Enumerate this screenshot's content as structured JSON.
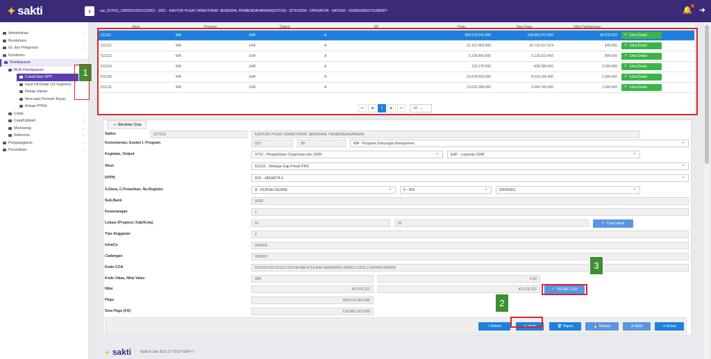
{
  "app": {
    "logo": "sakti",
    "header_info": "opr_527010_199503152016122001 - 2021 - KANTOR PUSAT DIREKTORAT JENDERAL PERBENDAHARAAN(527010) - 527010009 - OPERATOR - SATKER - 0150601995270100000?",
    "bell_icon": "bell-icon",
    "logout_icon": "logout-icon",
    "accent": "#3a2a78"
  },
  "sidebar": {
    "items": [
      {
        "label": "Administrasi",
        "level": 1,
        "dropdown": true
      },
      {
        "label": "Bendahara",
        "level": 1,
        "dropdown": true
      },
      {
        "label": "GL dan Pelaporan",
        "level": 1,
        "dropdown": true
      },
      {
        "label": "Komitmen",
        "level": 1,
        "dropdown": false
      },
      {
        "label": "Pembayaran",
        "level": 1,
        "dropdown": false
      },
      {
        "label": "RUH Pembayaran",
        "level": 2,
        "dropdown": false
      },
      {
        "label": "Catat/Ubah SPP",
        "level": 3,
        "dropdown": false
      },
      {
        "label": "Input FA Detail (16 Segmen)",
        "level": 3,
        "dropdown": false
      },
      {
        "label": "Rekap Harian",
        "level": 3,
        "dropdown": false
      },
      {
        "label": "Mencatat Perintah Bayar",
        "level": 3,
        "dropdown": false
      },
      {
        "label": "Rekap PPDH",
        "level": 3,
        "dropdown": false
      },
      {
        "label": "Cetak",
        "level": 2,
        "dropdown": true
      },
      {
        "label": "Catat/Upload",
        "level": 2,
        "dropdown": true
      },
      {
        "label": "Monitoring",
        "level": 2,
        "dropdown": true
      },
      {
        "label": "Referensi",
        "level": 2,
        "dropdown": true
      },
      {
        "label": "Penganggaran",
        "level": 1,
        "dropdown": true
      },
      {
        "label": "Persediaan",
        "level": 1,
        "dropdown": true
      }
    ]
  },
  "grid": {
    "headers": [
      "Akun",
      "Program",
      "Output",
      "SD",
      "Pagu",
      "Sisa Pagu",
      "Nilai Pembayaran",
      ""
    ],
    "rows": [
      {
        "akun": "511111",
        "program": "WA",
        "output": "EAF",
        "sd": "A",
        "pagu": "309.573.242.000",
        "sisa": "139.962.972.050",
        "nilai": "42.578.222",
        "action": "Lihat Detail"
      },
      {
        "akun": "511121",
        "program": "WA",
        "output": "EAF",
        "sd": "A",
        "pagu": "22.167.969.000",
        "sisa": "20.710.017.014",
        "nilai": "400.000",
        "action": "Lihat Detail"
      },
      {
        "akun": "511122",
        "program": "WA",
        "output": "EAF",
        "sd": "A",
        "pagu": "6.190.443.000",
        "sisa": "5.126.013.443",
        "nilai": "804.000",
        "action": "Lihat Detail"
      },
      {
        "akun": "511124",
        "program": "WA",
        "output": "EAF",
        "sd": "A",
        "pagu": "310.375.000",
        "sisa": "-428.390.000",
        "nilai": "3.000.000",
        "action": "Lihat Detail"
      },
      {
        "akun": "511126",
        "program": "WA",
        "output": "EAF",
        "sd": "A",
        "pagu": "16.978.929.000",
        "sisa": "8.019.146.400",
        "nilai": "2.000.000",
        "action": "Lihat Detail"
      },
      {
        "akun": "511131",
        "program": "WA",
        "output": "EAF",
        "sd": "A",
        "pagu": "13.032.289.000",
        "sisa": "6.944.745.000",
        "nilai": "1.000.000",
        "action": "Lihat Detail"
      }
    ],
    "pager": {
      "first": "⏮",
      "prev": "◀",
      "current": "1",
      "next": "▶",
      "last": "⏭",
      "page_size": "10"
    }
  },
  "coa": {
    "title": "Struktur Coa",
    "satker_label": "Satker",
    "satker_code": "527010",
    "satker_name": "KANTOR PUSAT DIREKTORAT JENDERAL PERBENDAHARAAN",
    "kementerian_label": "Kementerian, Eselon I, Program",
    "kem": "015",
    "eselon": "08",
    "program": "WA - Program Dukungan Manajemen",
    "kegiatan_label": "Kegiatan, Output",
    "kegiatan": "4719 - Pengelolaan Organisasi dan SDM",
    "output": "EAF - Layanan SDM",
    "akun_label": "Akun",
    "akun": "511111 - Belanja Gaji Pokok PNS",
    "kppn_label": "KPPN",
    "kppn": "019 - JAKARTA II",
    "sdana_label": "S.Dana, C.Penarikan, No.Register",
    "sdana": "A - RUPIAH MURNI",
    "cpen": "0 - RM",
    "noreg": "00000001",
    "subbank_label": "Sub.Bank",
    "subbank": "0000",
    "kewenangan_label": "Kewenangan",
    "kewenangan": "1",
    "lokasi_label": "Lokasi (Propinsi, Kab/Kota)",
    "propinsi": "01",
    "kabkota": "51",
    "cari_lokasi": "Cari Lokasi",
    "tipe_label": "Tipe Anggaran",
    "tipe": "2",
    "intraco_label": "IntraCo",
    "intraco": "000000",
    "cadangan_label": "Cadangan",
    "cadangan": "000000",
    "kodecoa_label": "Kode COA",
    "kodecoa": "527010.019.511111.015.08.WA.4719.EAF.A00000001.00000.1.0151.2.000000.000000",
    "valas_label": "Kode Valas, Nilai Valas",
    "valas": "IDR",
    "nilai_valas": "0,00",
    "nilai_label": "Nilai",
    "nilai": "42.578.222",
    "nilai2": "42.578.222",
    "detail_coa": "DETAIL COA",
    "pagu_label": "Pagu",
    "pagu": "309.573.242.000",
    "sisa_label": "Sisa Pagu (FA)",
    "sisa": "139.962.972.050"
  },
  "toolbar": {
    "rekam": "Rekam",
    "ubah": "Ubah",
    "hapus": "Hapus",
    "simpan": "Simpan",
    "batal": "Batal",
    "keluar": "Keluar"
  },
  "annotations": {
    "one": "1",
    "two": "2",
    "three": "3"
  },
  "footer": {
    "logo": "sakti",
    "build": "Build 8 Juni 2021 17:15:57 GMT+7"
  }
}
